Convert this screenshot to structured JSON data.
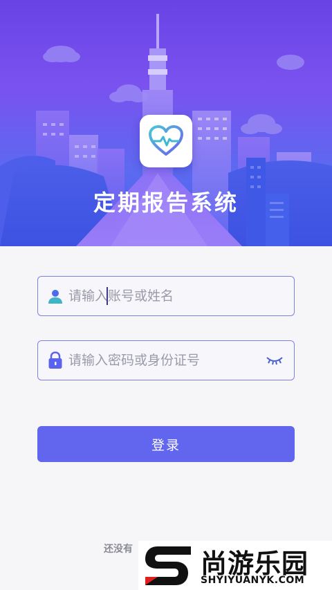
{
  "app": {
    "title": "定期报告系统"
  },
  "login_form": {
    "account_placeholder": "请输入账号或姓名",
    "password_placeholder": "请输入密码或身份证号",
    "login_label": "登录",
    "register_hint": "还没有"
  },
  "watermark": {
    "brand_cn": "尚游乐园",
    "brand_en": "SHYIYUANYK.COM"
  },
  "colors": {
    "accent": "#6266ee",
    "field_border": "#7f7fe0",
    "hero_top": "#6a43e6",
    "hero_bottom": "#4b62ec"
  },
  "icons": {
    "app_icon": "heart-pulse-icon",
    "account_icon": "user-icon",
    "password_icon": "lock-icon",
    "visibility_icon": "eye-closed-icon"
  }
}
